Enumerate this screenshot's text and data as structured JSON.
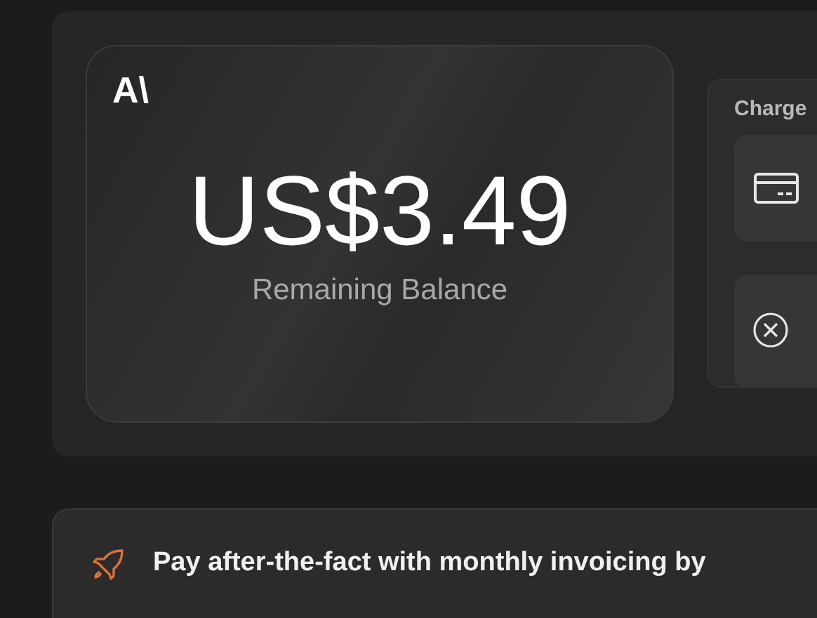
{
  "balance_card": {
    "logo": "A\\",
    "amount": "US$3.49",
    "label": "Remaining Balance"
  },
  "charge_panel": {
    "title": "Charge"
  },
  "banner": {
    "text": "Pay after-the-fact with monthly invoicing by"
  }
}
